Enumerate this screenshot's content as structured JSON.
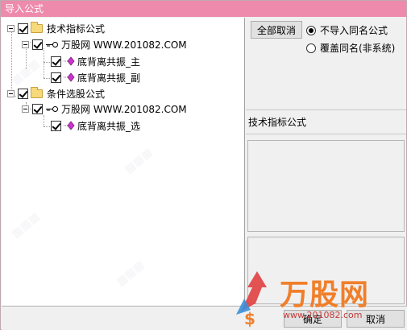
{
  "window": {
    "title": "导入公式"
  },
  "tree": {
    "nodes": [
      {
        "label": "技术指标公式",
        "type": "folder"
      },
      {
        "label": "万股网 WWW.201082.COM",
        "type": "key"
      },
      {
        "label": "底背离共振_主",
        "type": "formula"
      },
      {
        "label": "底背离共振_副",
        "type": "formula"
      },
      {
        "label": "条件选股公式",
        "type": "folder"
      },
      {
        "label": "万股网 WWW.201082.COM",
        "type": "key"
      },
      {
        "label": "底背离共振_选",
        "type": "formula"
      }
    ]
  },
  "right_panel": {
    "select_all_button": "全部取消",
    "radio_options": [
      {
        "label": "不导入同名公式",
        "selected": true
      },
      {
        "label": "覆盖同名(非系统)",
        "selected": false
      }
    ],
    "section_label": "技术指标公式"
  },
  "footer": {
    "ok_button": "确定",
    "cancel_button": "取消"
  },
  "watermark": {
    "logo_text": "万股网",
    "logo_url": "www.201082.com"
  },
  "colors": {
    "titlebar": "#ee8aab",
    "formula_icon": "#cc33cc",
    "logo": "#f07f2a"
  }
}
